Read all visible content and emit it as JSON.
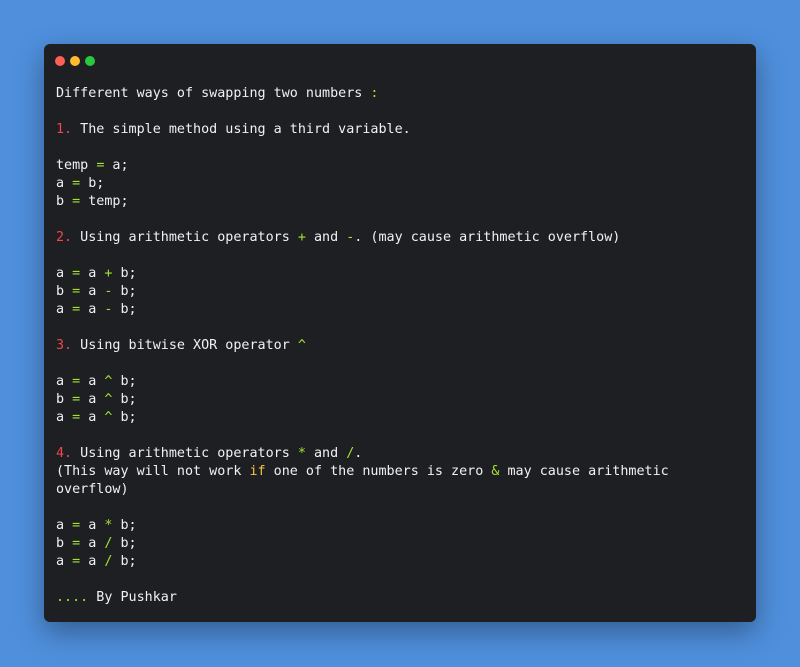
{
  "window": {
    "controls": [
      {
        "name": "close",
        "color": "#ff5f56"
      },
      {
        "name": "minimize",
        "color": "#ffbd2e"
      },
      {
        "name": "maximize",
        "color": "#27c93f"
      }
    ]
  },
  "colors": {
    "background": "#4f8fdc",
    "editor": "#1d1f22",
    "text": "#f1f1f1",
    "number": "#f0464b",
    "operator": "#a6e22e",
    "keyword": "#f6c343"
  },
  "code": {
    "lines": [
      [
        {
          "t": "Different ways of swapping two numbers "
        },
        {
          "t": ":",
          "c": "op"
        }
      ],
      [],
      [
        {
          "t": "1.",
          "c": "num"
        },
        {
          "t": " The simple method using a third variable."
        }
      ],
      [],
      [
        {
          "t": "temp "
        },
        {
          "t": "=",
          "c": "op"
        },
        {
          "t": " a;"
        }
      ],
      [
        {
          "t": "a "
        },
        {
          "t": "=",
          "c": "op"
        },
        {
          "t": " b;"
        }
      ],
      [
        {
          "t": "b "
        },
        {
          "t": "=",
          "c": "op"
        },
        {
          "t": " temp;"
        }
      ],
      [],
      [
        {
          "t": "2.",
          "c": "num"
        },
        {
          "t": " Using arithmetic operators "
        },
        {
          "t": "+",
          "c": "op"
        },
        {
          "t": " and "
        },
        {
          "t": "-",
          "c": "op"
        },
        {
          "t": ". (may cause arithmetic overflow)"
        }
      ],
      [],
      [
        {
          "t": "a "
        },
        {
          "t": "=",
          "c": "op"
        },
        {
          "t": " a "
        },
        {
          "t": "+",
          "c": "op"
        },
        {
          "t": " b;"
        }
      ],
      [
        {
          "t": "b "
        },
        {
          "t": "=",
          "c": "op"
        },
        {
          "t": " a "
        },
        {
          "t": "-",
          "c": "op"
        },
        {
          "t": " b;"
        }
      ],
      [
        {
          "t": "a "
        },
        {
          "t": "=",
          "c": "op"
        },
        {
          "t": " a "
        },
        {
          "t": "-",
          "c": "op"
        },
        {
          "t": " b;"
        }
      ],
      [],
      [
        {
          "t": "3.",
          "c": "num"
        },
        {
          "t": " Using bitwise XOR operator "
        },
        {
          "t": "^",
          "c": "op"
        }
      ],
      [],
      [
        {
          "t": "a "
        },
        {
          "t": "=",
          "c": "op"
        },
        {
          "t": " a "
        },
        {
          "t": "^",
          "c": "op"
        },
        {
          "t": " b;"
        }
      ],
      [
        {
          "t": "b "
        },
        {
          "t": "=",
          "c": "op"
        },
        {
          "t": " a "
        },
        {
          "t": "^",
          "c": "op"
        },
        {
          "t": " b;"
        }
      ],
      [
        {
          "t": "a "
        },
        {
          "t": "=",
          "c": "op"
        },
        {
          "t": " a "
        },
        {
          "t": "^",
          "c": "op"
        },
        {
          "t": " b;"
        }
      ],
      [],
      [
        {
          "t": "4.",
          "c": "num"
        },
        {
          "t": " Using arithmetic operators "
        },
        {
          "t": "*",
          "c": "op"
        },
        {
          "t": " and "
        },
        {
          "t": "/",
          "c": "op"
        },
        {
          "t": "."
        }
      ],
      [
        {
          "t": "(This way will not work "
        },
        {
          "t": "if",
          "c": "kw"
        },
        {
          "t": " one of the numbers is zero "
        },
        {
          "t": "&",
          "c": "op"
        },
        {
          "t": " may cause arithmetic"
        }
      ],
      [
        {
          "t": "overflow)"
        }
      ],
      [],
      [
        {
          "t": "a "
        },
        {
          "t": "=",
          "c": "op"
        },
        {
          "t": " a "
        },
        {
          "t": "*",
          "c": "op"
        },
        {
          "t": " b;"
        }
      ],
      [
        {
          "t": "b "
        },
        {
          "t": "=",
          "c": "op"
        },
        {
          "t": " a "
        },
        {
          "t": "/",
          "c": "op"
        },
        {
          "t": " b;"
        }
      ],
      [
        {
          "t": "a "
        },
        {
          "t": "=",
          "c": "op"
        },
        {
          "t": " a "
        },
        {
          "t": "/",
          "c": "op"
        },
        {
          "t": " b;"
        }
      ],
      [],
      [
        {
          "t": "....",
          "c": "op"
        },
        {
          "t": " By Pushkar"
        }
      ]
    ]
  }
}
